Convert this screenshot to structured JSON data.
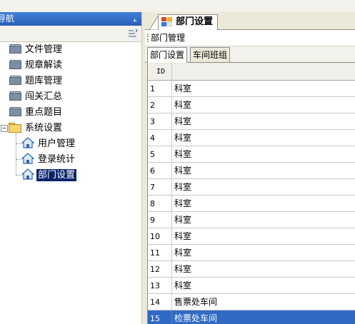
{
  "nav": {
    "title": "导航",
    "pin_glyph": "ꟼ",
    "tree": [
      {
        "label": "文件管理",
        "icon": "book-icon",
        "level": 0
      },
      {
        "label": "规章解读",
        "icon": "book-icon",
        "level": 0
      },
      {
        "label": "题库管理",
        "icon": "book-icon",
        "level": 0
      },
      {
        "label": "闯关汇总",
        "icon": "book-icon",
        "level": 0
      },
      {
        "label": "重点题目",
        "icon": "book-icon",
        "level": 0
      },
      {
        "label": "系统设置",
        "icon": "folder-open-icon",
        "level": 0,
        "expanded": true
      },
      {
        "label": "用户管理",
        "icon": "home-icon",
        "level": 1
      },
      {
        "label": "登录统计",
        "icon": "home-icon",
        "level": 1
      },
      {
        "label": "部门设置",
        "icon": "home-icon",
        "level": 1,
        "selected": true
      }
    ]
  },
  "document_tab": {
    "label": "部门设置",
    "icon": "window-icon"
  },
  "breadcrumb": {
    "label": "部门管理"
  },
  "sub_tabs": [
    {
      "label": "部门设置",
      "active": true
    },
    {
      "label": "车间班组",
      "active": false
    }
  ],
  "grid": {
    "columns": [
      "ID",
      ""
    ],
    "rows": [
      {
        "id": "1",
        "name": "科室"
      },
      {
        "id": "2",
        "name": "科室"
      },
      {
        "id": "3",
        "name": "科室"
      },
      {
        "id": "4",
        "name": "科室"
      },
      {
        "id": "5",
        "name": "科室"
      },
      {
        "id": "6",
        "name": "科室"
      },
      {
        "id": "7",
        "name": "科室"
      },
      {
        "id": "8",
        "name": "科室"
      },
      {
        "id": "9",
        "name": "科室"
      },
      {
        "id": "10",
        "name": "科室"
      },
      {
        "id": "11",
        "name": "科室"
      },
      {
        "id": "12",
        "name": "科室"
      },
      {
        "id": "13",
        "name": "科室"
      },
      {
        "id": "14",
        "name": "售票处车间"
      },
      {
        "id": "15",
        "name": "检票处车间",
        "selected": true
      }
    ]
  },
  "colors": {
    "nav_title_bg": "#2a5fb7",
    "selection_bg": "#316ac5",
    "tree_selection_bg": "#0a246a",
    "chrome_bg": "#ece9d8"
  }
}
